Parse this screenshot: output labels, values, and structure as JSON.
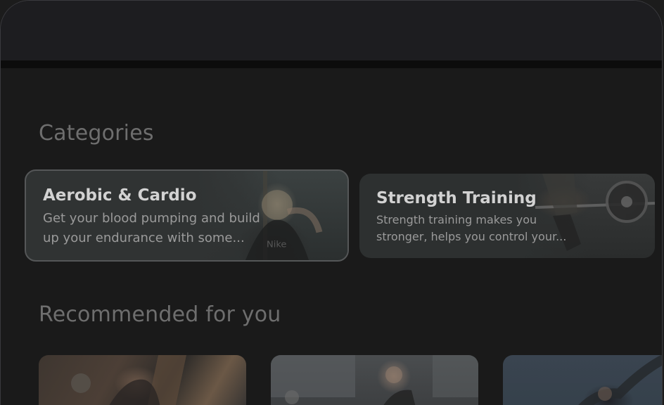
{
  "sections": {
    "categories_title": "Categories",
    "recommended_title": "Recommended for you"
  },
  "categories": [
    {
      "title": "Aerobic & Cardio",
      "description": "Get your blood pumping and build up your endurance with some...",
      "selected": true
    },
    {
      "title": "Strength Training",
      "description": "Strength training makes you stronger, helps you control your...",
      "selected": false
    }
  ],
  "colors": {
    "background": "#1a1a1a",
    "card_background": "#303333",
    "selected_border": "#555758",
    "section_title": "#6e6e6e",
    "card_title": "#d2d2d2",
    "card_description": "#9a9a9a"
  }
}
